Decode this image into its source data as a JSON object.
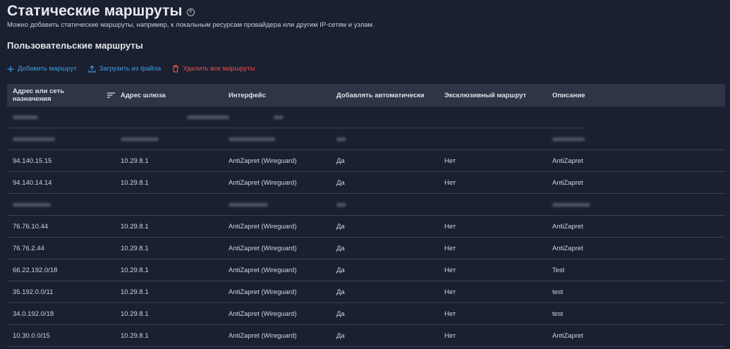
{
  "page": {
    "title": "Статические маршруты",
    "subtitle": "Можно добавить статические маршруты, например, к локальным ресурсам провайдера или другим IP-сетям и узлам.",
    "section_title": "Пользовательские маршруты",
    "help_icon": "help-circle-icon"
  },
  "toolbar": {
    "add_label": "Добавить маршрут",
    "upload_label": "Загрузить из файла",
    "delete_label": "Удалить все маршруты",
    "add_icon": "plus-icon",
    "upload_icon": "upload-icon",
    "delete_icon": "trash-icon",
    "colors": {
      "primary": "#3f9be0",
      "danger": "#e8504a"
    }
  },
  "table": {
    "columns": [
      "Адрес или сеть назначения",
      "Адрес шлюза",
      "Интерфейс",
      "Добавлять автоматически",
      "Эксклюзивный маршрут",
      "Описание"
    ],
    "rows": [
      [
        "94.140.15.15",
        "10.29.8.1",
        "AntiZapret (Wireguard)",
        "Да",
        "Нет",
        "AntiZapret"
      ],
      [
        "94.140.14.14",
        "10.29.8.1",
        "AntiZapret (Wireguard)",
        "Да",
        "Нет",
        "AntiZapret"
      ],
      [
        "76.76.10.44",
        "10.29.8.1",
        "AntiZapret (Wireguard)",
        "Да",
        "Нет",
        "AntiZapret"
      ],
      [
        "76.76.2.44",
        "10.29.8.1",
        "AntiZapret (Wireguard)",
        "Да",
        "Нет",
        "AntiZapret"
      ],
      [
        "66.22.192.0/18",
        "10.29.8.1",
        "AntiZapret (Wireguard)",
        "Да",
        "Нет",
        "Test"
      ],
      [
        "35.192.0.0/11",
        "10.29.8.1",
        "AntiZapret (Wireguard)",
        "Да",
        "Нет",
        "test"
      ],
      [
        "34.0.192.0/18",
        "10.29.8.1",
        "AntiZapret (Wireguard)",
        "Да",
        "Нет",
        "test"
      ],
      [
        "10.30.0.0/15",
        "10.29.8.1",
        "AntiZapret (Wireguard)",
        "Да",
        "Нет",
        "AntiZapret"
      ]
    ]
  }
}
